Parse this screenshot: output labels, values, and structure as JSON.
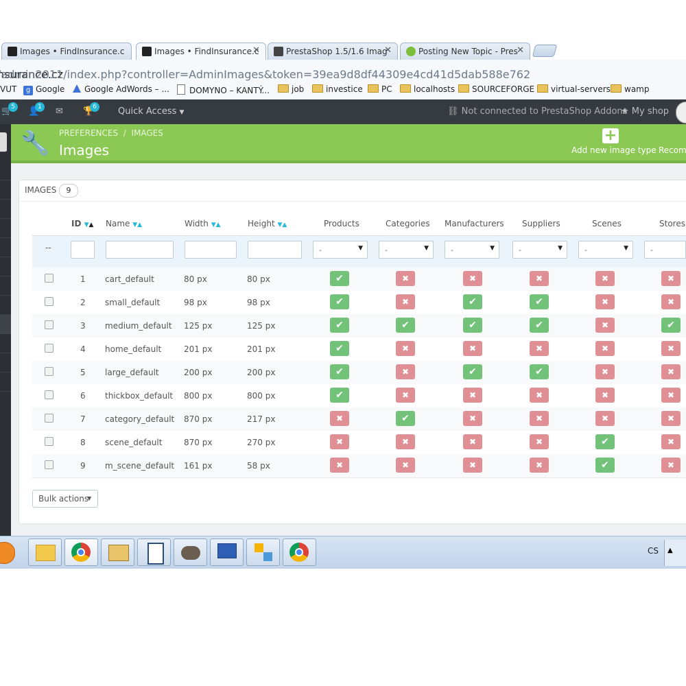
{
  "browser": {
    "tabs": [
      {
        "label": "Images • FindInsurance.c",
        "active": false
      },
      {
        "label": "Images • FindInsurance.c",
        "active": true
      },
      {
        "label": "PrestaShop 1.5/1.6 Imag",
        "active": false
      },
      {
        "label": "Posting New Topic - Pres",
        "active": false
      }
    ],
    "address_host": "nsurance.cz",
    "address_path": "/admin2011/index.php?controller=AdminImages&token=39ea9d8df44309e4cd41d5dab588e762",
    "bookmarks": [
      "VUT",
      "Google",
      "Google AdWords – ...",
      "DOMYNO – KANTÝ...",
      "job",
      "investice",
      "PC",
      "localhosts",
      "SOURCEFORGE",
      "virtual-servers",
      "wamp"
    ]
  },
  "header": {
    "cart_badge": "5",
    "customers_badge": "1",
    "trophy_badge": "6",
    "quick_access": "Quick Access",
    "addons_status": "Not connected to PrestaShop Addons",
    "my_shop": "My shop"
  },
  "toolbar": {
    "breadcrumb_1": "PREFERENCES",
    "breadcrumb_sep": "/",
    "breadcrumb_2": "IMAGES",
    "title": "Images",
    "add_button": "Add new image type",
    "recommend_button": "Recom"
  },
  "panel": {
    "heading": "IMAGES",
    "count": "9",
    "columns": [
      "ID",
      "Name",
      "Width",
      "Height",
      "Products",
      "Categories",
      "Manufacturers",
      "Suppliers",
      "Scenes",
      "Stores"
    ],
    "filter_dash": "--",
    "select_placeholder": "-",
    "bulk_actions": "Bulk actions"
  },
  "rows": [
    {
      "id": "1",
      "name": "cart_default",
      "width": "80 px",
      "height": "80 px",
      "flags": [
        true,
        false,
        false,
        false,
        false,
        false
      ]
    },
    {
      "id": "2",
      "name": "small_default",
      "width": "98 px",
      "height": "98 px",
      "flags": [
        true,
        false,
        true,
        true,
        false,
        false
      ]
    },
    {
      "id": "3",
      "name": "medium_default",
      "width": "125 px",
      "height": "125 px",
      "flags": [
        true,
        true,
        true,
        true,
        false,
        true
      ]
    },
    {
      "id": "4",
      "name": "home_default",
      "width": "201 px",
      "height": "201 px",
      "flags": [
        true,
        false,
        false,
        false,
        false,
        false
      ]
    },
    {
      "id": "5",
      "name": "large_default",
      "width": "200 px",
      "height": "200 px",
      "flags": [
        true,
        false,
        true,
        true,
        false,
        false
      ]
    },
    {
      "id": "6",
      "name": "thickbox_default",
      "width": "800 px",
      "height": "800 px",
      "flags": [
        true,
        false,
        false,
        false,
        false,
        false
      ]
    },
    {
      "id": "7",
      "name": "category_default",
      "width": "870 px",
      "height": "217 px",
      "flags": [
        false,
        true,
        false,
        false,
        false,
        false
      ]
    },
    {
      "id": "8",
      "name": "scene_default",
      "width": "870 px",
      "height": "270 px",
      "flags": [
        false,
        false,
        false,
        false,
        true,
        false
      ]
    },
    {
      "id": "9",
      "name": "m_scene_default",
      "width": "161 px",
      "height": "58 px",
      "flags": [
        false,
        false,
        false,
        false,
        true,
        false
      ]
    }
  ],
  "taskbar": {
    "language": "CS"
  },
  "colors": {
    "toolbar_green": "#8bc954",
    "ok_green": "#72c279",
    "no_red": "#e08f95",
    "accent_blue": "#25b9d7",
    "header_dark": "#363a41"
  }
}
